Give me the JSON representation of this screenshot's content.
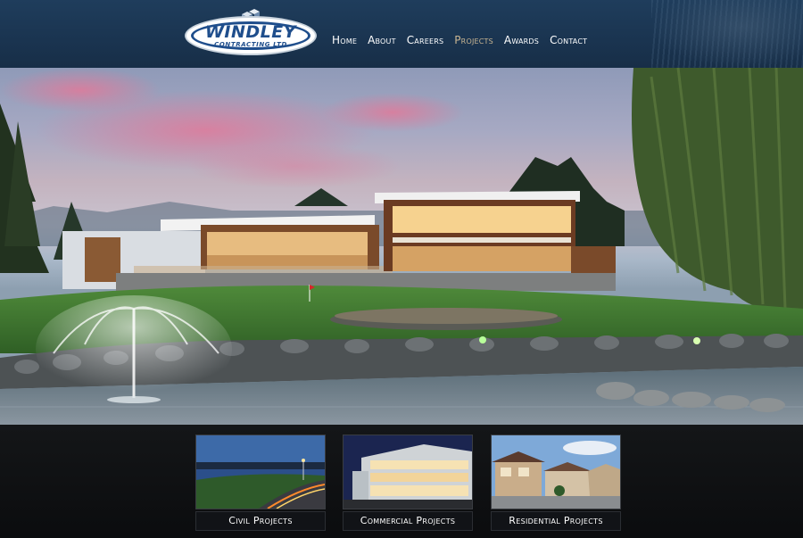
{
  "header": {
    "logo": {
      "title": "WINDLEY",
      "subtitle": "CONTRACTING LTD"
    },
    "nav": [
      {
        "label": "Home",
        "active": false
      },
      {
        "label": "About",
        "active": false
      },
      {
        "label": "Careers",
        "active": false
      },
      {
        "label": "Projects",
        "active": true
      },
      {
        "label": "Awards",
        "active": false
      },
      {
        "label": "Contact",
        "active": false
      }
    ],
    "colors": {
      "background": "#1a3450",
      "nav_text": "#ffffff",
      "nav_active": "#c9b592",
      "logo_blue": "#1f4e8c"
    }
  },
  "hero": {
    "image": "golf-clubhouse-photo"
  },
  "projects": [
    {
      "label": "Civil Projects",
      "image": "highway-night-photo"
    },
    {
      "label": "Commercial Projects",
      "image": "office-building-photo"
    },
    {
      "label": "Residential Projects",
      "image": "townhouses-photo"
    }
  ]
}
